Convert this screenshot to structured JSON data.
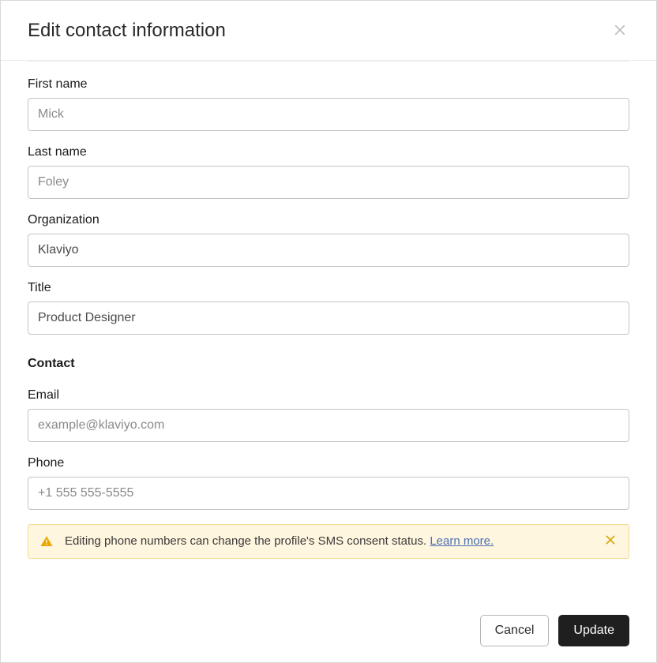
{
  "dialog": {
    "title": "Edit contact information",
    "fields": {
      "first_name": {
        "label": "First name",
        "value": "Mick"
      },
      "last_name": {
        "label": "Last name",
        "value": "Foley"
      },
      "organization": {
        "label": "Organization",
        "value": "Klaviyo"
      },
      "title_field": {
        "label": "Title",
        "value": "Product Designer"
      }
    },
    "contact_section": {
      "heading": "Contact",
      "email": {
        "label": "Email",
        "placeholder": "example@klaviyo.com",
        "value": ""
      },
      "phone": {
        "label": "Phone",
        "placeholder": "+1 555 555-5555",
        "value": ""
      }
    },
    "alert": {
      "text": "Editing phone numbers can change the profile's SMS consent status. ",
      "link_text": "Learn more."
    },
    "buttons": {
      "cancel": "Cancel",
      "update": "Update"
    }
  }
}
